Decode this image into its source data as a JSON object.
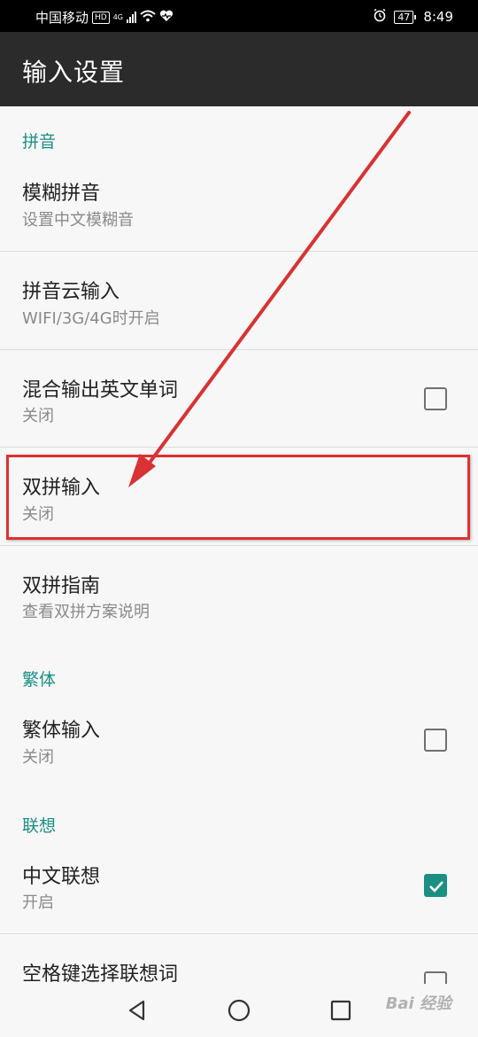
{
  "status_bar": {
    "carrier": "中国移动",
    "hd": "HD",
    "network": "4G",
    "battery": "47",
    "time": "8:49"
  },
  "app_bar": {
    "title": "输入设置"
  },
  "sections": [
    {
      "header": "拼音"
    },
    {
      "header": "繁体"
    },
    {
      "header": "联想"
    }
  ],
  "prefs": [
    {
      "title": "模糊拼音",
      "summary": "设置中文模糊音"
    },
    {
      "title": "拼音云输入",
      "summary": "WIFI/3G/4G时开启"
    },
    {
      "title": "混合输出英文单词",
      "summary": "关闭",
      "checked": false
    },
    {
      "title": "双拼输入",
      "summary": "关闭"
    },
    {
      "title": "双拼指南",
      "summary": "查看双拼方案说明"
    },
    {
      "title": "繁体输入",
      "summary": "关闭",
      "checked": false
    },
    {
      "title": "中文联想",
      "summary": "开启",
      "checked": true
    },
    {
      "title": "空格键选择联想词",
      "checked": false
    }
  ],
  "colors": {
    "accent": "#1b8f84",
    "annotation": "#e03030",
    "app_bar": "#2b2b2b"
  },
  "watermark": "Bai 经验"
}
